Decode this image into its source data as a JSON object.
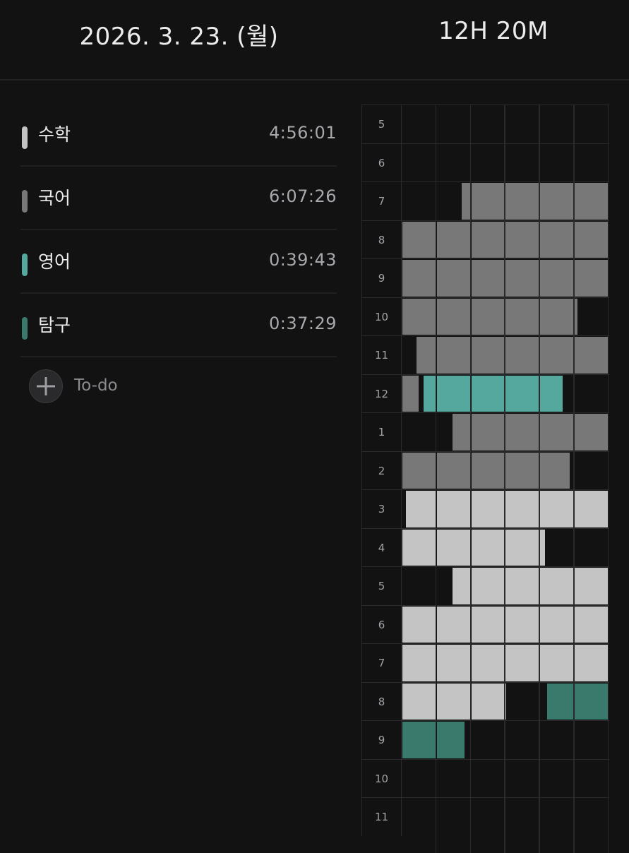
{
  "header": {
    "date": "2026. 3. 23. (월)",
    "total": "12H 20M"
  },
  "subjects": [
    {
      "name": "수학",
      "time": "4:56:01",
      "color": "#c4c4c4"
    },
    {
      "name": "국어",
      "time": "6:07:26",
      "color": "#787878"
    },
    {
      "name": "영어",
      "time": "0:39:43",
      "color": "#54a89e"
    },
    {
      "name": "탐구",
      "time": "0:37:29",
      "color": "#3a7a6c"
    }
  ],
  "todo": {
    "label": "To-do",
    "icon": "plus-icon"
  },
  "timeline": {
    "hours": [
      "5",
      "6",
      "7",
      "8",
      "9",
      "10",
      "11",
      "12",
      "1",
      "2",
      "3",
      "4",
      "5",
      "6",
      "7",
      "8",
      "9",
      "10",
      "11"
    ],
    "rows": [
      [],
      [],
      [
        {
          "s": 0,
          "from": 1.72,
          "to": 6
        }
      ],
      [
        {
          "s": 0,
          "from": 0,
          "to": 6
        }
      ],
      [
        {
          "s": 0,
          "from": 0,
          "to": 6
        }
      ],
      [
        {
          "s": 0,
          "from": 0,
          "to": 5.13
        }
      ],
      [
        {
          "s": 0,
          "from": 0.42,
          "to": 6
        }
      ],
      [
        {
          "s": 0,
          "from": 0,
          "to": 0.52
        },
        {
          "s": 1,
          "from": 0.62,
          "to": 4.7
        }
      ],
      [
        {
          "s": 0,
          "from": 1.45,
          "to": 6
        }
      ],
      [
        {
          "s": 0,
          "from": 0,
          "to": 4.9
        }
      ],
      [
        {
          "s": 2,
          "from": 0.1,
          "to": 6
        }
      ],
      [
        {
          "s": 2,
          "from": 0,
          "to": 4.18
        }
      ],
      [
        {
          "s": 2,
          "from": 1.45,
          "to": 6
        }
      ],
      [
        {
          "s": 2,
          "from": 0,
          "to": 6
        }
      ],
      [
        {
          "s": 2,
          "from": 0,
          "to": 6
        }
      ],
      [
        {
          "s": 2,
          "from": 0,
          "to": 3.05
        },
        {
          "s": 3,
          "from": 4.2,
          "to": 6
        }
      ],
      [
        {
          "s": 3,
          "from": 0,
          "to": 1.85
        }
      ],
      [],
      []
    ],
    "slot_colors": [
      "#787878",
      "#54a89e",
      "#c4c4c4",
      "#3a7a6c"
    ]
  }
}
